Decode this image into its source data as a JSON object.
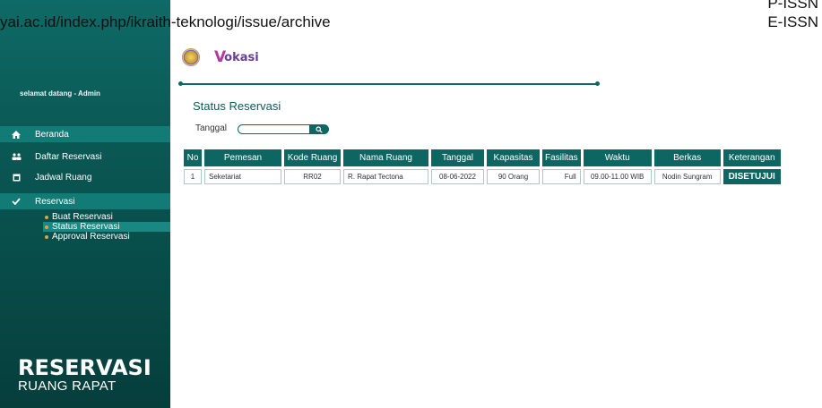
{
  "overlay": {
    "url_text": "yai.ac.id/index.php/ikraith-teknologi/issue/archive",
    "pissn": "P-ISSN",
    "eissn": "E-ISSN"
  },
  "sidebar": {
    "welcome": "selamat datang - Admin",
    "items": [
      {
        "label": "Beranda",
        "icon": "home-icon"
      },
      {
        "label": "Daftar Reservasi",
        "icon": "people-icon"
      },
      {
        "label": "Jadwal Ruang",
        "icon": "calendar-icon"
      },
      {
        "label": "Reservasi",
        "icon": "check-icon"
      }
    ],
    "subitems": [
      {
        "label": "Buat Reservasi"
      },
      {
        "label": "Status Reservasi",
        "active": true
      },
      {
        "label": "Approval Reservasi"
      }
    ],
    "brand_big": "RESERVASI",
    "brand_small": "RUANG RAPAT"
  },
  "header": {
    "logo_text": "okasi",
    "logo_v": "V"
  },
  "main": {
    "title": "Status Reservasi",
    "date_label": "Tanggal",
    "date_value": ""
  },
  "table": {
    "headers": [
      "No",
      "Pemesan",
      "Kode Ruang",
      "Nama Ruang",
      "Tanggal",
      "Kapasitas",
      "Fasilitas",
      "Waktu",
      "Berkas",
      "Keterangan"
    ],
    "rows": [
      [
        "1",
        "Seketariat",
        "RR02",
        "R. Rapat Tectona",
        "08-06-2022",
        "90 Orang",
        "Full",
        "09.00-11.00 WIB",
        "Nodin Sungram",
        "DISETUJUI"
      ]
    ]
  },
  "colors": {
    "primary": "#0d6662",
    "sidebar_top": "#0e6a66",
    "sidebar_bottom": "#063e3c",
    "accent_dot": "#e0a43a"
  }
}
